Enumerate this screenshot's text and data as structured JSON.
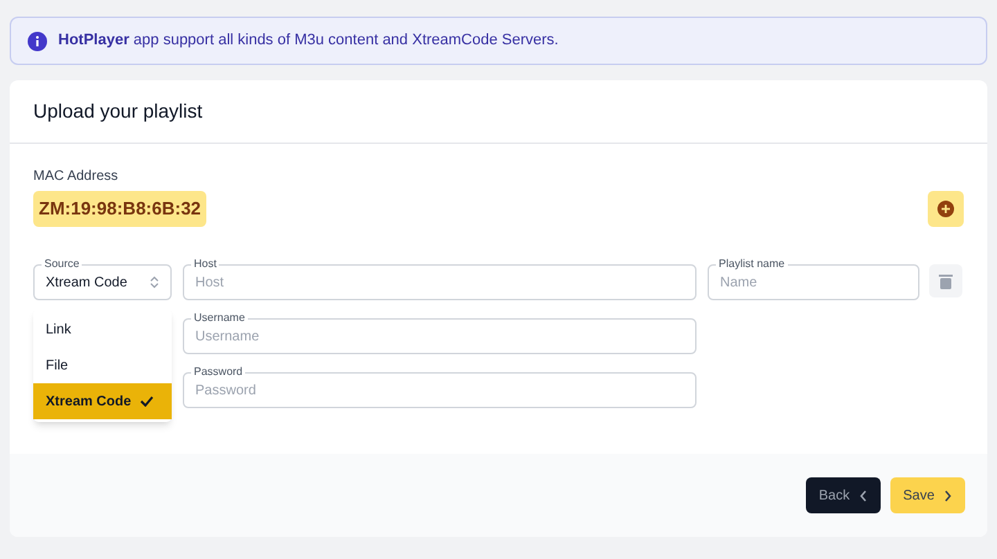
{
  "info_banner": {
    "text": "**HotPlayer** app support all kinds of M3u content and XtreamCode Servers."
  },
  "card": {
    "title": "Upload your playlist",
    "mac": {
      "label": "MAC Address",
      "value": "ZM:19:98:B8:6B:32"
    },
    "source": {
      "label": "Source",
      "value": "Xtream Code",
      "expanded": true,
      "options": [
        {
          "label": "Link",
          "selected": false
        },
        {
          "label": "File",
          "selected": false
        },
        {
          "label": "Xtream Code",
          "selected": true
        }
      ]
    },
    "fields": [
      {
        "label": "Host",
        "placeholder": "Host"
      },
      {
        "label": "Username",
        "placeholder": "Username"
      },
      {
        "label": "Password",
        "placeholder": "Password"
      }
    ],
    "playlist_name": {
      "label": "Playlist name",
      "placeholder": "Name"
    },
    "buttons": [
      {
        "label": "Back",
        "kind": "back"
      },
      {
        "label": "Save",
        "kind": "save"
      }
    ]
  }
}
